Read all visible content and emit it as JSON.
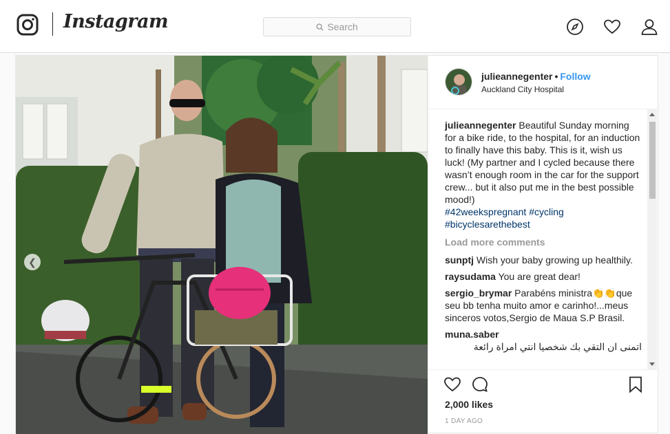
{
  "header": {
    "brand": "Instagram",
    "search_placeholder": "Search",
    "icons": [
      "instagram-logo-icon",
      "search-icon",
      "compass-icon",
      "heart-icon",
      "profile-icon"
    ]
  },
  "post": {
    "username": "julieannegenter",
    "separator": "•",
    "follow_label": "Follow",
    "location": "Auckland City Hospital",
    "caption": {
      "user": "julieannegenter",
      "text": "Beautiful Sunday morning for a bike ride, to the hospital, for an induction to finally have this baby. This is it, wish us luck! (My partner and I cycled because there wasn’t enough room in the car for the support crew... but it also put me in the best possible mood!)",
      "hashtags": [
        "#42weekspregnant",
        "#cycling",
        "#bicyclesarethebest"
      ]
    },
    "load_more_label": "Load more comments",
    "comments": [
      {
        "user": "sunptj",
        "text": "Wish your baby growing up healthily."
      },
      {
        "user": "raysudama",
        "text": "You are great dear!"
      },
      {
        "user": "sergio_brymar",
        "text": "Parabéns ministra👏👏que seu bb tenha muito amor e carinho!...meus sinceros votos,Sergio de Maua S.P Brasil."
      },
      {
        "user": "muna.saber",
        "text": "اتمنى ان التقي بك شخصيا انتي امراة رائعة"
      }
    ],
    "likes": "2,000 likes",
    "time": "1 DAY AGO"
  },
  "colors": {
    "accent_link": "#3897f0",
    "hashtag": "#003569",
    "border": "#dbdbdb"
  }
}
